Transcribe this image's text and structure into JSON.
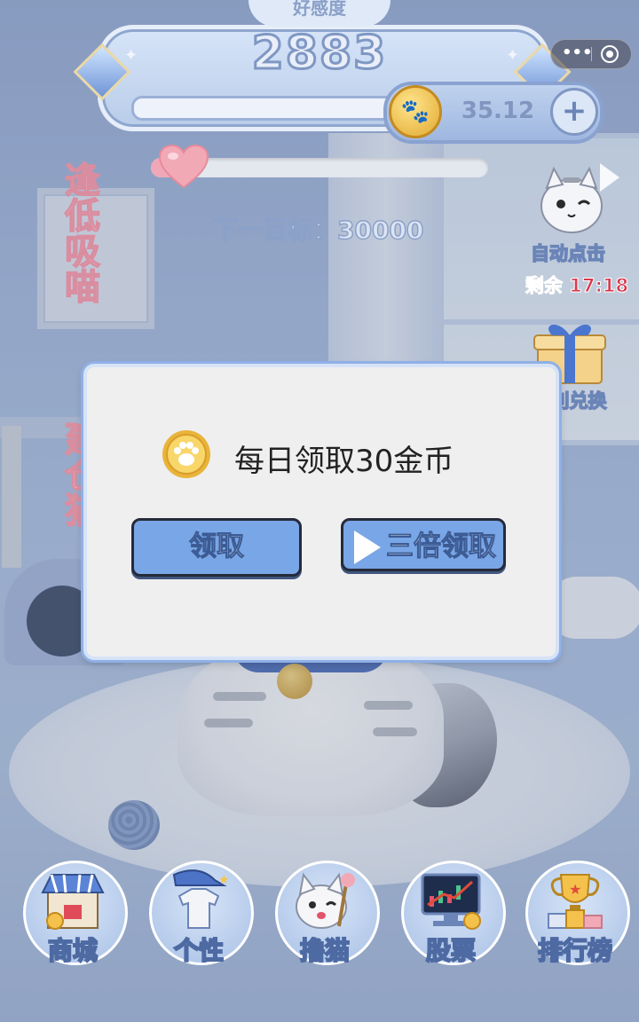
{
  "header": {
    "affection_title": "好感度",
    "affection_value": "2883",
    "coin_balance": "35.12",
    "add_coin_symbol": "+"
  },
  "progress": {
    "next_goal": "下一目标：30000",
    "fraction": 0.0961
  },
  "left_banner": {
    "line1": "逢低吸喵",
    "line2": "建仓猫"
  },
  "side_actions": {
    "auto_click_label": "自动点击",
    "auto_click_timer": "剩余 17:18",
    "exchange_label": "利兑换"
  },
  "modal": {
    "title": "每日领取30金币",
    "claim_label": "领取",
    "triple_claim_label": "三倍领取"
  },
  "bottom_nav": {
    "items": [
      {
        "label": "商城",
        "icon": "shop-icon"
      },
      {
        "label": "个性",
        "icon": "outfit-icon"
      },
      {
        "label": "撸猫",
        "icon": "pet-cat-icon"
      },
      {
        "label": "股票",
        "icon": "stock-chart-icon"
      },
      {
        "label": "排行榜",
        "icon": "trophy-icon"
      }
    ]
  },
  "colors": {
    "button_blue": "#79a6e6",
    "coin_gold": "#e1a932",
    "timer_red": "#d8394d",
    "heart_pink": "#f0a8b8"
  }
}
